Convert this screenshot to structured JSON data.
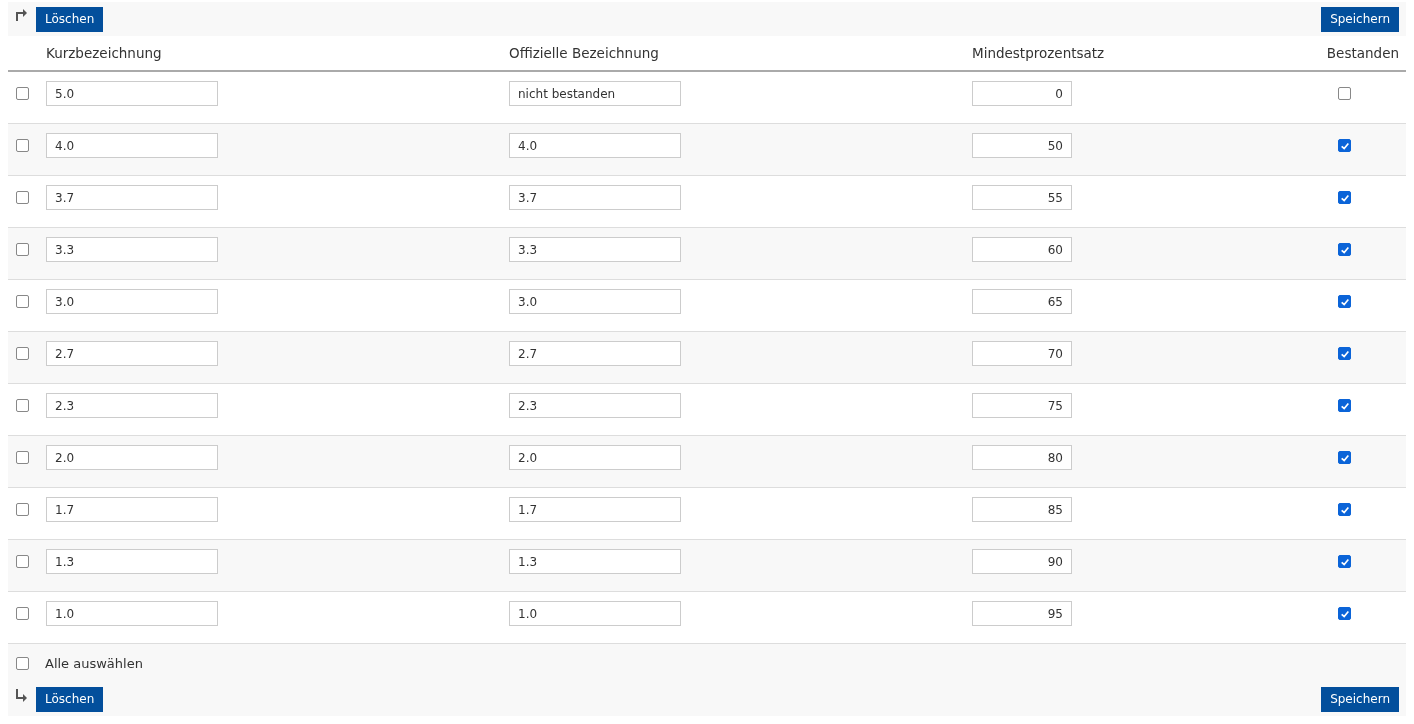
{
  "top_toolbar": {
    "delete_button": "Löschen",
    "save_button": "Speichern"
  },
  "table": {
    "columns": [
      "Kurzbezeichnung",
      "Offizielle Bezeichnung",
      "Mindestprozentsatz",
      "Bestanden"
    ],
    "rows": [
      {
        "selected": false,
        "short_name": "5.0",
        "official_name": "nicht bestanden",
        "min_percent": "0",
        "passed": false
      },
      {
        "selected": false,
        "short_name": "4.0",
        "official_name": "4.0",
        "min_percent": "50",
        "passed": true
      },
      {
        "selected": false,
        "short_name": "3.7",
        "official_name": "3.7",
        "min_percent": "55",
        "passed": true
      },
      {
        "selected": false,
        "short_name": "3.3",
        "official_name": "3.3",
        "min_percent": "60",
        "passed": true
      },
      {
        "selected": false,
        "short_name": "3.0",
        "official_name": "3.0",
        "min_percent": "65",
        "passed": true
      },
      {
        "selected": false,
        "short_name": "2.7",
        "official_name": "2.7",
        "min_percent": "70",
        "passed": true
      },
      {
        "selected": false,
        "short_name": "2.3",
        "official_name": "2.3",
        "min_percent": "75",
        "passed": true
      },
      {
        "selected": false,
        "short_name": "2.0",
        "official_name": "2.0",
        "min_percent": "80",
        "passed": true
      },
      {
        "selected": false,
        "short_name": "1.7",
        "official_name": "1.7",
        "min_percent": "85",
        "passed": true
      },
      {
        "selected": false,
        "short_name": "1.3",
        "official_name": "1.3",
        "min_percent": "90",
        "passed": true
      },
      {
        "selected": false,
        "short_name": "1.0",
        "official_name": "1.0",
        "min_percent": "95",
        "passed": true
      }
    ]
  },
  "select_all": {
    "label": "Alle auswählen",
    "checked": false
  },
  "bottom_toolbar": {
    "delete_button": "Löschen",
    "save_button": "Speichern"
  }
}
